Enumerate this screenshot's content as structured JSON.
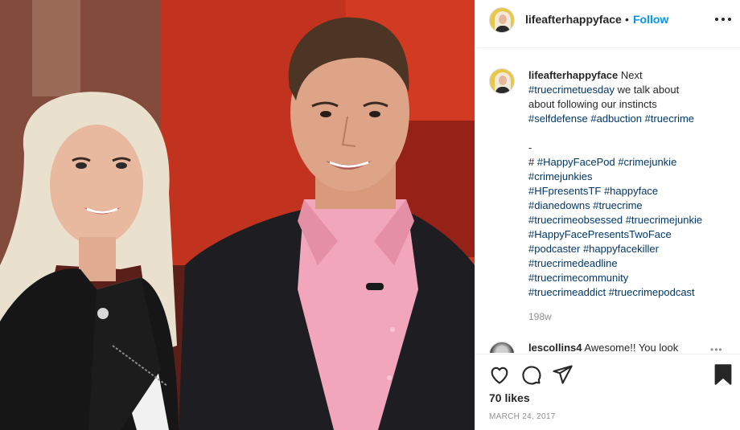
{
  "post": {
    "author": "lifeafterhappyface",
    "separator": "•",
    "follow_label": "Follow",
    "photo_alt": "",
    "caption": {
      "username": "lifeafterhappyface",
      "lead_word": "Next",
      "tag_truecrimetuesday": "#truecrimetuesday",
      "line1_rest": "we talk about",
      "line2": "about following our instincts",
      "line3": [
        {
          "text": "#selfdefense",
          "tag": true
        },
        {
          "text": "#adbuction",
          "tag": true
        },
        {
          "text": "#truecrime",
          "tag": true
        }
      ],
      "dash": "-",
      "hash_prefix": "#",
      "hashtag_lines": [
        [
          "#HappyFacePod",
          "#crimejunkie"
        ],
        [
          "#crimejunkies"
        ],
        [
          "#HFpresentsTF",
          "#happyface"
        ],
        [
          "#dianedowns",
          "#truecrime"
        ],
        [
          "#truecrimeobsessed",
          "#truecrimejunkie"
        ],
        [
          "#HappyFacePresentsTwoFace"
        ],
        [
          "#podcaster",
          "#happyfacekiller"
        ],
        [
          "#truecrimedeadline"
        ],
        [
          "#truecrimecommunity"
        ],
        [
          "#truecrimeaddict",
          "#truecrimepodcast"
        ]
      ],
      "time": "198w"
    },
    "comment": {
      "username": "lescollins4",
      "text": "Awesome!! You look"
    },
    "more_comment_icon": "ellipsis-icon",
    "likes": "70 likes",
    "date": "MARCH 24, 2017"
  },
  "icons": {
    "like": "heart-icon",
    "comment": "comment-bubble-icon",
    "share": "paper-plane-icon",
    "save": "bookmark-icon",
    "more": "more-dots-icon"
  },
  "colors": {
    "link": "#0095f6",
    "hashtag": "#00376b",
    "muted": "#8e8e8e",
    "text": "#262626"
  }
}
